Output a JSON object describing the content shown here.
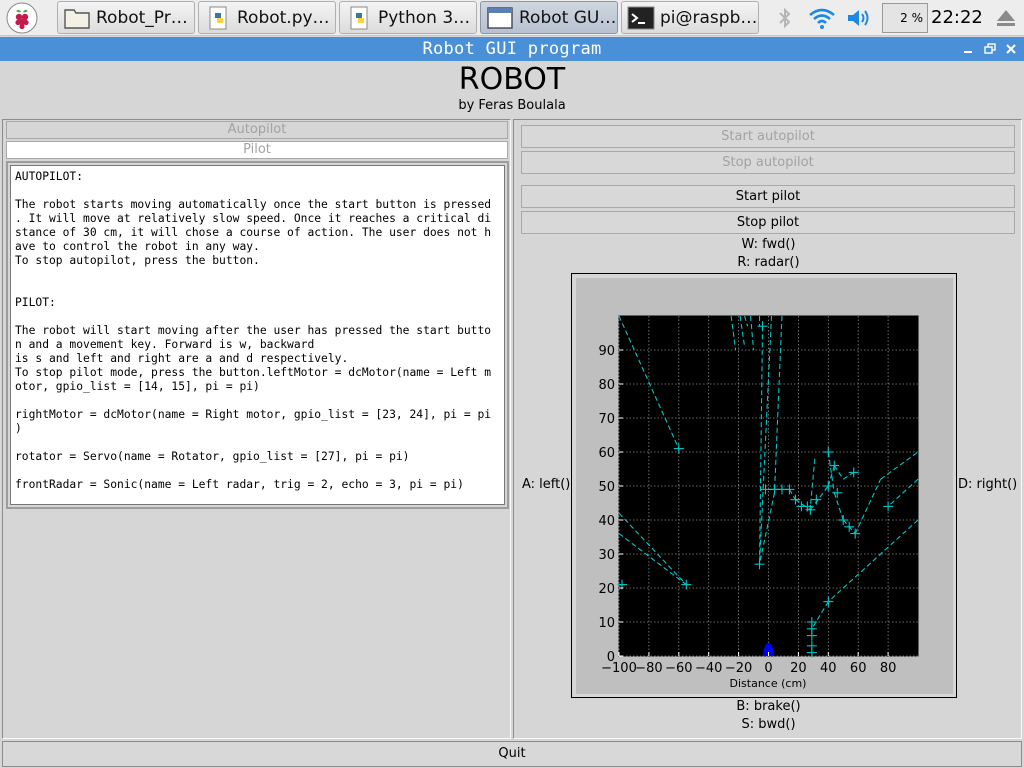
{
  "taskbar": {
    "start_icon": "raspberry-pi-icon",
    "tasks": [
      {
        "label": "Robot_Pr…",
        "icon": "folder-icon"
      },
      {
        "label": "Robot.py…",
        "icon": "python-file-icon"
      },
      {
        "label": "Python 3…",
        "icon": "python-file-icon"
      },
      {
        "label": "Robot GU…",
        "icon": "window-icon"
      },
      {
        "label": "pi@raspb…",
        "icon": "terminal-icon"
      }
    ],
    "cpu_usage": "2 %",
    "clock": "22:22"
  },
  "window": {
    "title": "Robot GUI program",
    "app_title": "ROBOT",
    "author": "by Feras Boulala"
  },
  "left": {
    "autopilot_label": "Autopilot",
    "pilot_label": "Pilot",
    "info_text": "AUTOPILOT:\n\nThe robot starts moving automatically once the start button is pressed\n. It will move at relatively slow speed. Once it reaches a critical di\nstance of 30 cm, it will chose a course of action. The user does not h\nave to control the robot in any way.\nTo stop autopilot, press the button.\n\n\nPILOT:\n\nThe robot will start moving after the user has pressed the start butto\nn and a movement key. Forward is w, backward\nis s and left and right are a and d respectively.\nTo stop pilot mode, press the button.leftMotor = dcMotor(name = Left m\notor, gpio_list = [14, 15], pi = pi)\n\nrightMotor = dcMotor(name = Right motor, gpio_list = [23, 24], pi = pi\n)\n\nrotator = Servo(name = Rotator, gpio_list = [27], pi = pi)\n\nfrontRadar = Sonic(name = Left radar, trig = 2, echo = 3, pi = pi)"
  },
  "right": {
    "start_autopilot": "Start autopilot",
    "stop_autopilot": "Stop autopilot",
    "start_pilot": "Start pilot",
    "stop_pilot": "Stop pilot",
    "key_fwd": "W: fwd()",
    "key_radar": "R: radar()",
    "key_left": "A: left()",
    "key_right": "D: right()",
    "key_brake": "B: brake()",
    "key_bwd": "S: bwd()"
  },
  "quit_label": "Quit",
  "chart_data": {
    "type": "scatter",
    "xlabel": "Distance (cm)",
    "ylabel": "",
    "xlim": [
      -100,
      100
    ],
    "ylim": [
      0,
      100
    ],
    "xticks": [
      -100,
      -80,
      -60,
      -40,
      -20,
      0,
      20,
      40,
      60,
      80
    ],
    "yticks": [
      0,
      10,
      20,
      30,
      40,
      50,
      60,
      70,
      80,
      90
    ],
    "grid": true,
    "background": "#000000",
    "line_color": "#00c8c8",
    "robot_color": "#0000ff",
    "robot_position": [
      0,
      2
    ],
    "segments": [
      [
        [
          -100,
          100
        ],
        [
          -60,
          61
        ]
      ],
      [
        [
          -100,
          42
        ],
        [
          -55,
          21
        ]
      ],
      [
        [
          -100,
          36
        ],
        [
          -55,
          21
        ]
      ],
      [
        [
          -100,
          21
        ],
        [
          -98,
          21
        ]
      ],
      [
        [
          -25,
          100
        ],
        [
          -22,
          90
        ]
      ],
      [
        [
          -19,
          100
        ],
        [
          -16,
          91
        ]
      ],
      [
        [
          -16,
          100
        ],
        [
          -14,
          97
        ]
      ],
      [
        [
          -12,
          100
        ],
        [
          -10,
          90
        ]
      ],
      [
        [
          -6,
          100
        ],
        [
          -6,
          97
        ]
      ],
      [
        [
          -4,
          97
        ],
        [
          -6,
          27
        ]
      ],
      [
        [
          2,
          100
        ],
        [
          -6,
          27
        ]
      ],
      [
        [
          9,
          100
        ],
        [
          4,
          48
        ]
      ],
      [
        [
          4,
          48
        ],
        [
          -6,
          27
        ]
      ],
      [
        [
          14,
          49
        ],
        [
          -2,
          49
        ]
      ],
      [
        [
          14,
          49
        ],
        [
          18,
          46
        ]
      ],
      [
        [
          18,
          46
        ],
        [
          28,
          43
        ]
      ],
      [
        [
          28,
          43
        ],
        [
          40,
          50
        ]
      ],
      [
        [
          40,
          50
        ],
        [
          44,
          56
        ]
      ],
      [
        [
          44,
          56
        ],
        [
          50,
          52
        ]
      ],
      [
        [
          50,
          52
        ],
        [
          57,
          54
        ]
      ],
      [
        [
          40,
          60
        ],
        [
          44,
          48
        ]
      ],
      [
        [
          44,
          48
        ],
        [
          50,
          40
        ]
      ],
      [
        [
          50,
          40
        ],
        [
          58,
          36
        ]
      ],
      [
        [
          58,
          36
        ],
        [
          75,
          52
        ]
      ],
      [
        [
          75,
          52
        ],
        [
          100,
          60
        ]
      ],
      [
        [
          100,
          52
        ],
        [
          80,
          44
        ]
      ],
      [
        [
          100,
          40
        ],
        [
          40,
          16
        ]
      ],
      [
        [
          40,
          16
        ],
        [
          29,
          8
        ]
      ],
      [
        [
          31,
          58
        ],
        [
          28,
          44
        ]
      ]
    ],
    "markers": [
      [
        -60,
        61
      ],
      [
        -55,
        21
      ],
      [
        -98,
        21
      ],
      [
        -6,
        27
      ],
      [
        -4,
        97
      ],
      [
        -2,
        49
      ],
      [
        4,
        49
      ],
      [
        9,
        49
      ],
      [
        14,
        49
      ],
      [
        18,
        46
      ],
      [
        22,
        44
      ],
      [
        26,
        44
      ],
      [
        28,
        43
      ],
      [
        32,
        46
      ],
      [
        40,
        50
      ],
      [
        44,
        56
      ],
      [
        40,
        60
      ],
      [
        46,
        48
      ],
      [
        50,
        40
      ],
      [
        54,
        38
      ],
      [
        57,
        54
      ],
      [
        58,
        36
      ],
      [
        80,
        44
      ],
      [
        40,
        16
      ],
      [
        29,
        8
      ],
      [
        29,
        3
      ],
      [
        29,
        6
      ],
      [
        29,
        10
      ],
      [
        29,
        1
      ]
    ]
  }
}
